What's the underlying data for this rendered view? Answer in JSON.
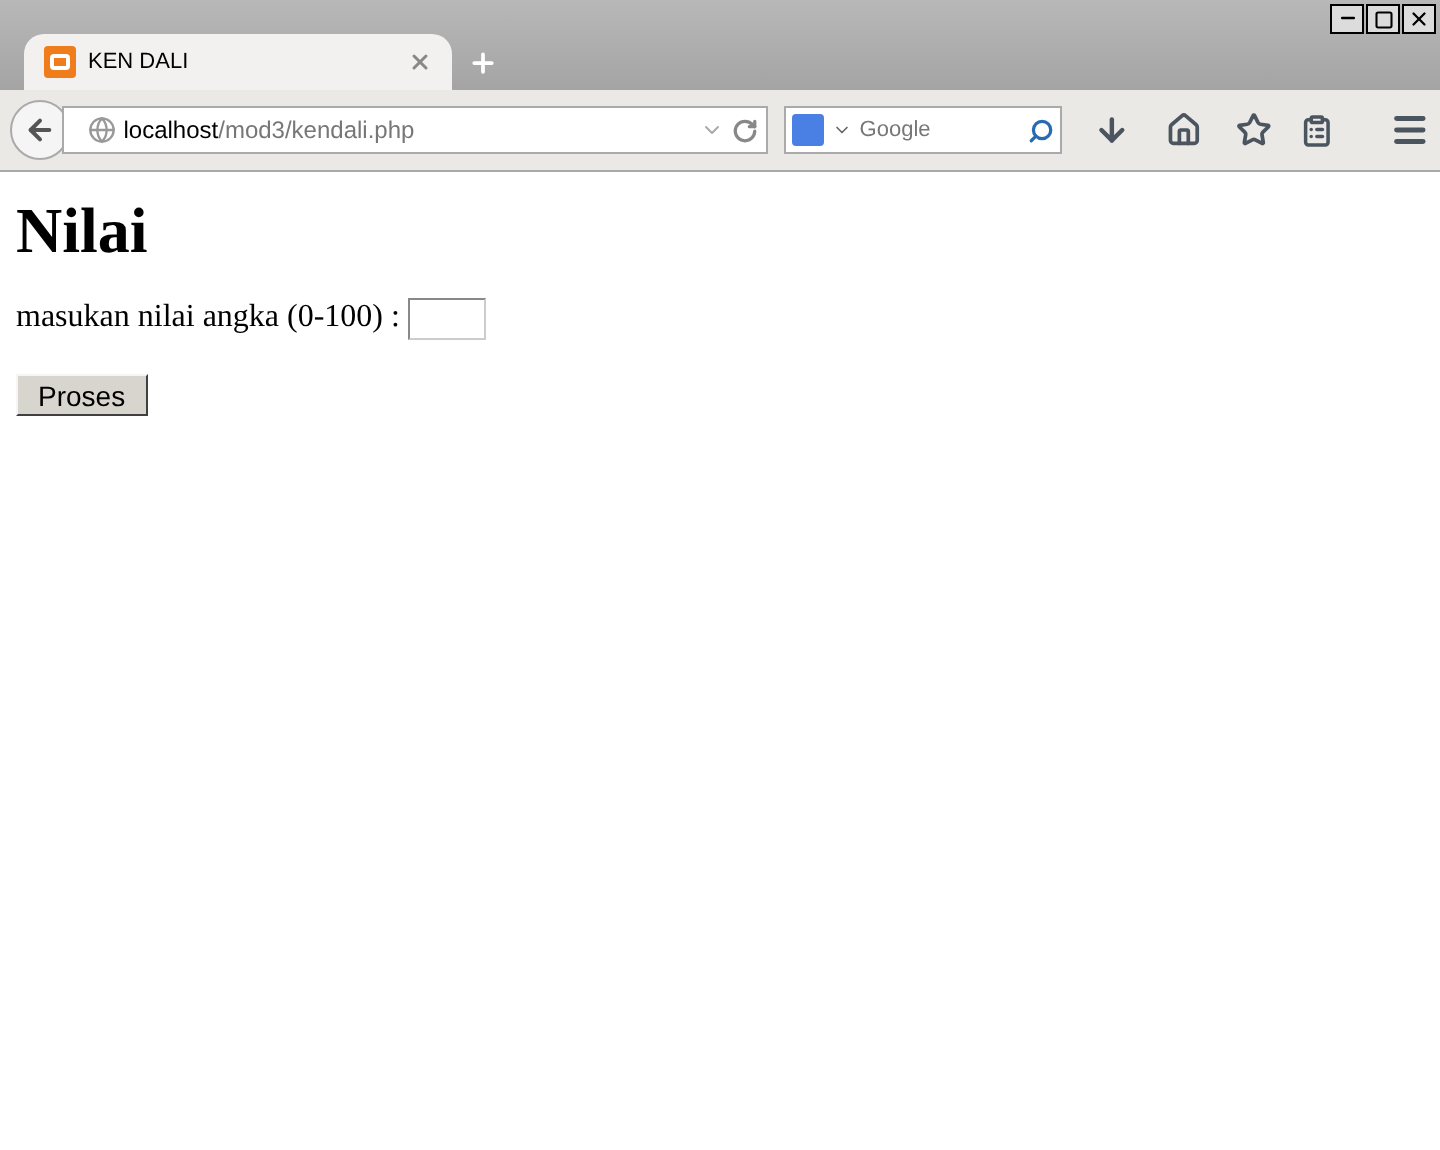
{
  "tabs": [
    {
      "title": "KEN DALI",
      "selected": true
    }
  ],
  "address": {
    "host": "localhost",
    "path": "/mod3/kendali.php"
  },
  "search": {
    "placeholder": "Google"
  },
  "page": {
    "heading": "Nilai",
    "label": "masukan nilai angka (0-100) :",
    "button": "Proses"
  }
}
